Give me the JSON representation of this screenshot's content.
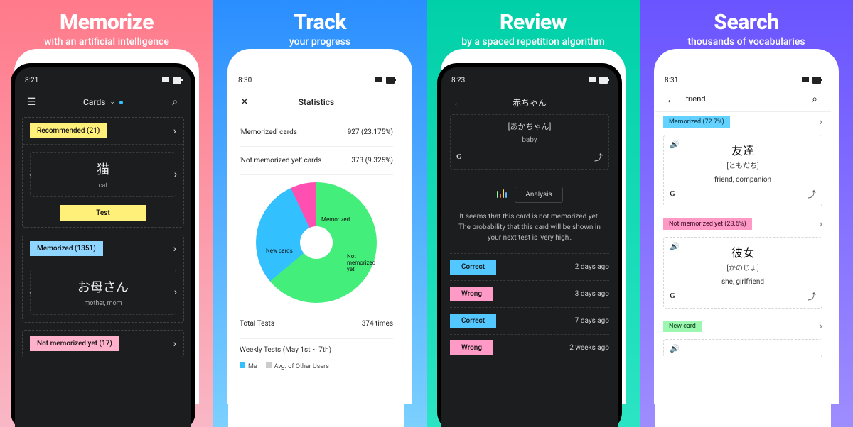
{
  "panels": [
    {
      "title": "Memorize",
      "sub": "with an artificial intelligence"
    },
    {
      "title": "Track",
      "sub": "your progress"
    },
    {
      "title": "Review",
      "sub": "by a spaced repetition algorithm"
    },
    {
      "title": "Search",
      "sub": "thousands of vocabularies"
    }
  ],
  "p1": {
    "time": "8:21",
    "title": "Cards",
    "recommended": "Recommended (21)",
    "card1_jp": "猫",
    "card1_en": "cat",
    "test": "Test",
    "memorized": "Memorized (1351)",
    "card2_jp": "お母さん",
    "card2_en": "mother, mom",
    "notmem": "Not memorized yet (17)"
  },
  "p2": {
    "time": "8:30",
    "title": "Statistics",
    "row1_l": "'Memorized' cards",
    "row1_r": "927 (23.175%)",
    "row2_l": "'Not memorized yet' cards",
    "row2_r": "373 (9.325%)",
    "donut": {
      "memorized": "Memorized",
      "notmem": "Not memorized yet",
      "new": "New cards"
    },
    "total_l": "Total Tests",
    "total_r": "374 times",
    "weekly": "Weekly Tests (May 1st ~ 7th)",
    "legend_me": "Me",
    "legend_avg": "Avg. of Other Users"
  },
  "p3": {
    "time": "8:23",
    "title": "赤ちゃん",
    "kana": "[あかちゃん]",
    "en": "baby",
    "analysis": "Analysis",
    "msg": "It seems that this card is not memorized yet. The probability that this card will be shown in your next test is 'very high'.",
    "hist": [
      {
        "result": "Correct",
        "when": "2 days ago",
        "color": "cyan"
      },
      {
        "result": "Wrong",
        "when": "3 days ago",
        "color": "pink"
      },
      {
        "result": "Correct",
        "when": "7 days ago",
        "color": "cyan"
      },
      {
        "result": "Wrong",
        "when": "2 weeks ago",
        "color": "pink"
      }
    ]
  },
  "p4": {
    "time": "8:31",
    "query": "friend",
    "grp1": "Memorized (72.7%)",
    "grp2": "Not memorized yet (28.6%)",
    "grp3": "New card",
    "c1_jp": "友達",
    "c1_kana": "[ともだち]",
    "c1_en": "friend, companion",
    "c2_jp": "彼女",
    "c2_kana": "[かのじょ]",
    "c2_en": "she, girlfriend"
  },
  "chart_data": {
    "type": "pie",
    "title": "Statistics",
    "series": [
      {
        "name": "New cards",
        "value": 64,
        "color": "#44ee7a"
      },
      {
        "name": "Memorized",
        "value": 29,
        "color": "#33c0ff"
      },
      {
        "name": "Not memorized yet",
        "value": 7,
        "color": "#ff4fb1"
      }
    ]
  }
}
